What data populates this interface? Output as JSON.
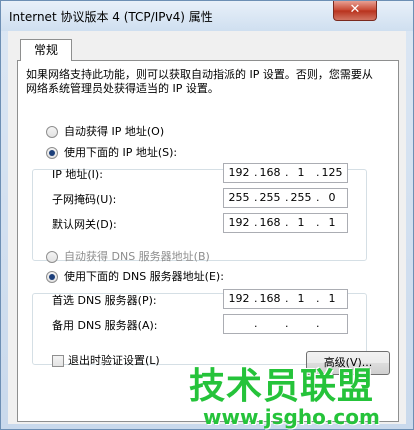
{
  "window": {
    "title": "Internet 协议版本 4 (TCP/IPv4) 属性",
    "close_label": "✕"
  },
  "tabs": [
    {
      "label": "常规"
    }
  ],
  "description": "如果网络支持此功能，则可以获取自动指派的 IP 设置。否则，您需要从网络系统管理员处获得适当的 IP 设置。",
  "ip_section": {
    "auto_label": "自动获得 IP 地址(O)",
    "auto_checked": false,
    "manual_label": "使用下面的 IP 地址(S):",
    "manual_checked": true,
    "fields": [
      {
        "label": "IP 地址(I):",
        "parts": [
          "192",
          "168",
          "1",
          "125"
        ]
      },
      {
        "label": "子网掩码(U):",
        "parts": [
          "255",
          "255",
          "255",
          "0"
        ]
      },
      {
        "label": "默认网关(D):",
        "parts": [
          "192",
          "168",
          "1",
          "1"
        ]
      }
    ]
  },
  "dns_section": {
    "auto_label": "自动获得 DNS 服务器地址(B)",
    "auto_checked": false,
    "auto_disabled": true,
    "manual_label": "使用下面的 DNS 服务器地址(E):",
    "manual_checked": true,
    "fields": [
      {
        "label": "首选 DNS 服务器(P):",
        "parts": [
          "192",
          "168",
          "1",
          "1"
        ]
      },
      {
        "label": "备用 DNS 服务器(A):",
        "parts": [
          "",
          "",
          "",
          ""
        ]
      }
    ]
  },
  "footer": {
    "validate_label": "退出时验证设置(L)",
    "validate_checked": false,
    "advanced_label": "高级(V)..."
  },
  "watermark": {
    "title": "技术员联盟",
    "url": "www.jsgho.com"
  }
}
